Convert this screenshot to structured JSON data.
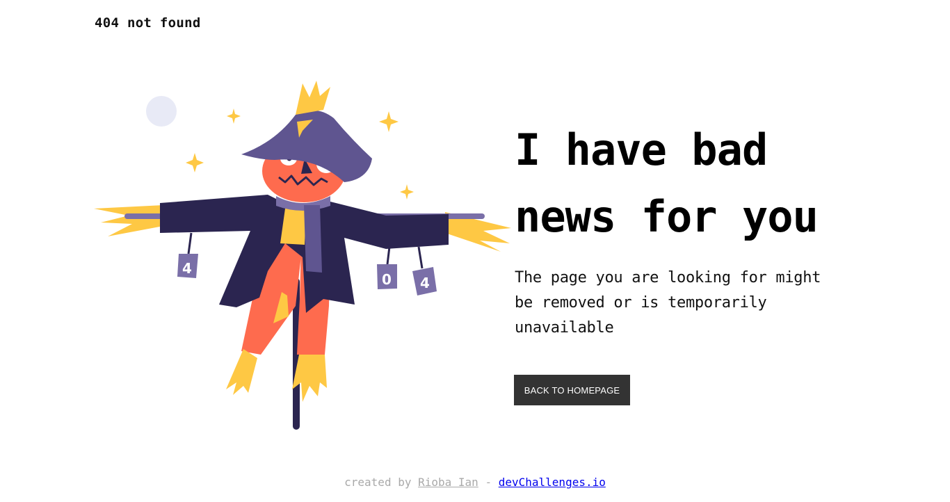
{
  "header": {
    "title": "404 not found"
  },
  "main": {
    "headline_line1": "I have bad",
    "headline_line2": "news for you",
    "description": "The page you are looking for might be removed or is temporarily unavailable",
    "button_label": "BACK TO HOMEPAGE"
  },
  "illustration": {
    "can_digits": [
      "4",
      "0",
      "4"
    ],
    "colors": {
      "hat": "#5f5590",
      "coat": "#2b2550",
      "head": "#fe6b4e",
      "straw": "#fec844",
      "scarf": "#7a6fa8",
      "moon": "#e8eaf6"
    }
  },
  "footer": {
    "prefix": "created by",
    "author": "Rioba Ian",
    "separator": "-",
    "site": "devChallenges.io"
  }
}
